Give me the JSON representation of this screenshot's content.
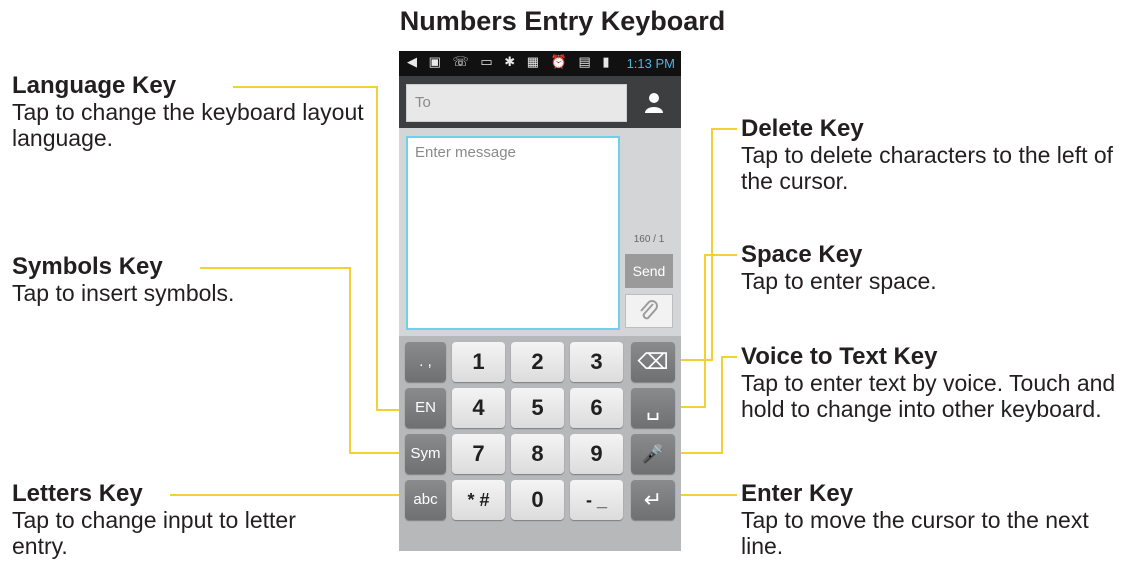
{
  "title": "Numbers Entry Keyboard",
  "callouts": {
    "language": {
      "heading": "Language Key",
      "desc": "Tap to change the keyboard layout language."
    },
    "symbols": {
      "heading": "Symbols Key",
      "desc": "Tap to insert symbols."
    },
    "letters": {
      "heading": "Letters Key",
      "desc": "Tap to change input to letter entry."
    },
    "delete": {
      "heading": "Delete Key",
      "desc": "Tap to delete characters to the left of the cursor."
    },
    "space": {
      "heading": "Space Key",
      "desc": "Tap to enter space."
    },
    "voice": {
      "heading": "Voice to Text Key",
      "desc": "Tap to enter text by voice. Touch and hold to change into other keyboard."
    },
    "enter": {
      "heading": "Enter Key",
      "desc": "Tap to move the cursor to the next line."
    }
  },
  "phone": {
    "status_icons": "◀ ▣ ☏ ▭ ✱ ▦ ⏰ ▤ ▮",
    "time": "1:13 PM",
    "to_placeholder": "To",
    "message_placeholder": "Enter message",
    "counter": "160 / 1",
    "send_label": "Send",
    "attach_icon": "paperclip-icon",
    "contact_icon": "person-icon"
  },
  "keys": {
    "row1": [
      ". ,",
      "1",
      "2",
      "3",
      "⌫"
    ],
    "row2": [
      "EN",
      "4",
      "5",
      "6",
      "␣"
    ],
    "row3": [
      "Sym",
      "7",
      "8",
      "9",
      "🎤"
    ],
    "row4": [
      "abc",
      "* #",
      "0",
      "- _",
      "↵"
    ]
  },
  "colors": {
    "leader": "#f5d033",
    "text": "#231f20",
    "accent": "#6fd0ea"
  }
}
